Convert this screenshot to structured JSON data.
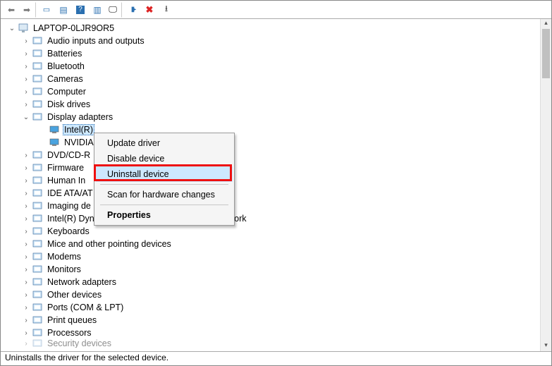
{
  "toolbar_icons": [
    "back-icon",
    "forward-icon",
    "show-hide-console-tree-icon",
    "properties-icon",
    "help-icon",
    "action-icon",
    "monitors-icon",
    "plugin-icon",
    "remove-icon",
    "scan-icon"
  ],
  "root": {
    "label": "LAPTOP-0LJR9OR5"
  },
  "categories": [
    {
      "label": "Audio inputs and outputs",
      "state": "collapsed",
      "icon": "speaker-icon"
    },
    {
      "label": "Batteries",
      "state": "collapsed",
      "icon": "battery-icon"
    },
    {
      "label": "Bluetooth",
      "state": "collapsed",
      "icon": "bluetooth-icon"
    },
    {
      "label": "Cameras",
      "state": "collapsed",
      "icon": "camera-icon"
    },
    {
      "label": "Computer",
      "state": "collapsed",
      "icon": "computer-icon"
    },
    {
      "label": "Disk drives",
      "state": "collapsed",
      "icon": "disk-icon"
    },
    {
      "label": "Display adapters",
      "state": "expanded",
      "icon": "display-icon",
      "children": [
        {
          "label": "Intel(R)",
          "selected": true
        },
        {
          "label": "NVIDIA"
        }
      ]
    },
    {
      "label": "DVD/CD-R",
      "state": "collapsed",
      "icon": "optical-icon",
      "truncated": true
    },
    {
      "label": "Firmware",
      "state": "collapsed",
      "icon": "firmware-icon"
    },
    {
      "label": "Human In",
      "state": "collapsed",
      "icon": "hid-icon",
      "truncated": true
    },
    {
      "label": "IDE ATA/AT",
      "state": "collapsed",
      "icon": "ide-icon",
      "truncated": true
    },
    {
      "label": "Imaging de",
      "state": "collapsed",
      "icon": "imaging-icon",
      "truncated": true
    },
    {
      "label": "Intel(R) Dynamic Platform and Thermal Framework",
      "state": "collapsed",
      "icon": "cpu-icon"
    },
    {
      "label": "Keyboards",
      "state": "collapsed",
      "icon": "keyboard-icon"
    },
    {
      "label": "Mice and other pointing devices",
      "state": "collapsed",
      "icon": "mouse-icon"
    },
    {
      "label": "Modems",
      "state": "collapsed",
      "icon": "modem-icon"
    },
    {
      "label": "Monitors",
      "state": "collapsed",
      "icon": "monitor-icon"
    },
    {
      "label": "Network adapters",
      "state": "collapsed",
      "icon": "network-icon"
    },
    {
      "label": "Other devices",
      "state": "collapsed",
      "icon": "other-icon"
    },
    {
      "label": "Ports (COM & LPT)",
      "state": "collapsed",
      "icon": "port-icon"
    },
    {
      "label": "Print queues",
      "state": "collapsed",
      "icon": "printer-icon"
    },
    {
      "label": "Processors",
      "state": "collapsed",
      "icon": "processor-icon"
    },
    {
      "label": "Security devices",
      "state": "collapsed",
      "icon": "security-icon",
      "cutoff": true
    }
  ],
  "context_menu": {
    "items": [
      {
        "label": "Update driver"
      },
      {
        "label": "Disable device"
      },
      {
        "label": "Uninstall device",
        "highlight": true,
        "annot": true
      },
      {
        "sep": true
      },
      {
        "label": "Scan for hardware changes"
      },
      {
        "sep": true
      },
      {
        "label": "Properties",
        "bold": true
      }
    ]
  },
  "statusbar": "Uninstalls the driver for the selected device.",
  "colors": {
    "highlight": "#cde8ff",
    "annot": "#e11"
  }
}
